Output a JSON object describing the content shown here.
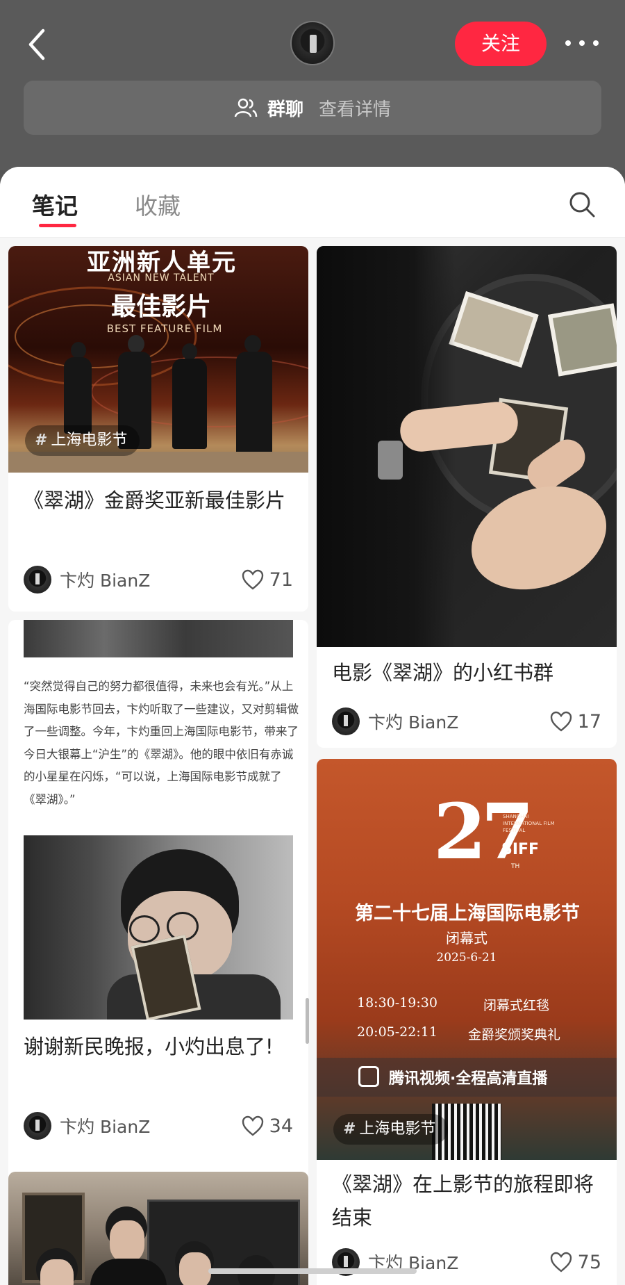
{
  "header": {
    "back_icon": "chevron-left-icon",
    "follow_label": "关注",
    "more_label": "···",
    "group_title": "群聊",
    "group_detail": "查看详情"
  },
  "tabs": {
    "notes": "笔记",
    "favorites": "收藏"
  },
  "colors": {
    "accent": "#ff2741",
    "header_bg": "#5a5a5a",
    "panel_bg": "#f6f6f6"
  },
  "cards": [
    {
      "image_text_line1": "亚洲新人单元",
      "image_text_line2": "ASIAN NEW TALENT",
      "image_text_line3": "最佳影片",
      "image_text_line4": "BEST FEATURE FILM",
      "tag": "上海电影节",
      "title": "《翠湖》金爵奖亚新最佳影片",
      "author": "卞灼 BianZ",
      "likes": "71"
    },
    {
      "title": "电影《翠湖》的小红书群",
      "author": "卞灼 BianZ",
      "likes": "17"
    },
    {
      "quote": "“突然觉得自己的努力都很值得，未来也会有光。”从上海国际电影节回去，卞灼听取了一些建议，又对剪辑做了一些调整。今年，卞灼重回上海国际电影节，带来了今日大银幕上“沪生”的《翠湖》。他的眼中依旧有赤诚的小星星在闪烁，“可以说，上海国际电影节成就了《翠湖》。”",
      "title": "谢谢新民晚报，小灼出息了!",
      "author": "卞灼 BianZ",
      "likes": "34"
    },
    {
      "poster_number": "27",
      "poster_th": "TH",
      "poster_festival": "SHANGHAI INTERNATIONAL FILM FESTIVAL",
      "poster_siff": "SIFF",
      "poster_title": "第二十七届上海国际电影节",
      "poster_subtitle": "闭幕式",
      "poster_date": "2025-6-21",
      "poster_time1": "18:30-19:30",
      "poster_event1": "闭幕式红毯",
      "poster_time2": "20:05-22:11",
      "poster_event2": "金爵奖颁奖典礼",
      "poster_stream": "腾讯视频·全程高清直播",
      "tag": "上海电影节",
      "title": "《翠湖》在上影节的旅程即将结束",
      "author": "卞灼 BianZ",
      "likes": "75"
    }
  ]
}
